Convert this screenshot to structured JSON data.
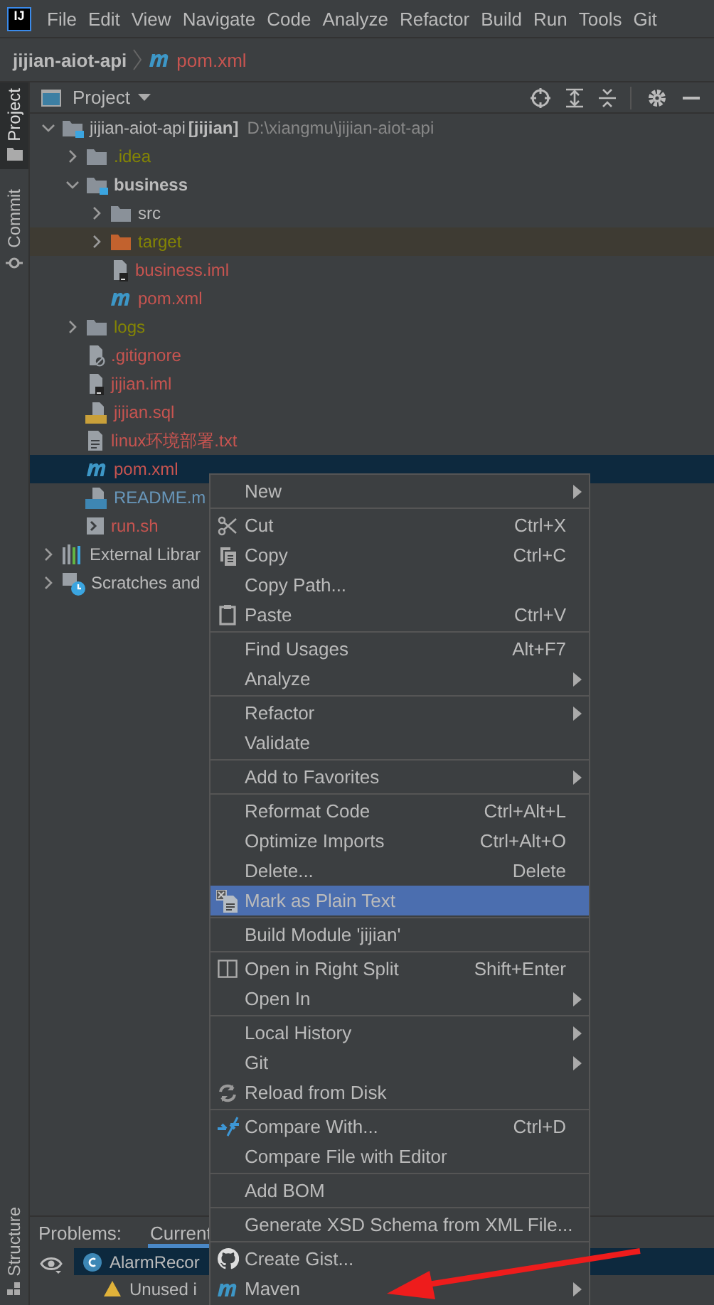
{
  "logo": "IJ",
  "menu_bar": [
    "File",
    "Edit",
    "View",
    "Navigate",
    "Code",
    "Analyze",
    "Refactor",
    "Build",
    "Run",
    "Tools",
    "Git"
  ],
  "breadcrumb": {
    "project": "jijian-aiot-api",
    "file": "pom.xml"
  },
  "left_stripe": [
    {
      "label": "Project",
      "selected": true
    },
    {
      "label": "Commit",
      "selected": false
    }
  ],
  "left_stripe_bottom": {
    "label": "Structure"
  },
  "project_panel": {
    "title": "Project",
    "tree": [
      {
        "name": "jijian-aiot-api",
        "module": "[jijian]",
        "path": "D:\\xiangmu\\jijian-aiot-api",
        "kind": "module",
        "color": "#bbbbbb",
        "expanded": true,
        "selected": false,
        "children": [
          {
            "name": ".idea",
            "kind": "folder",
            "color": "#848504",
            "expanded": false,
            "selected": false
          },
          {
            "name": "business",
            "kind": "module",
            "color": "#bbbbbb",
            "expanded": true,
            "selected": false,
            "children": [
              {
                "name": "src",
                "kind": "folder",
                "color": "#bbbbbb",
                "expanded": false,
                "selected": false
              },
              {
                "name": "target",
                "kind": "excluded",
                "color": "#848504",
                "expanded": false,
                "selected": false
              },
              {
                "name": "business.iml",
                "kind": "iml",
                "color": "#c75450",
                "selected": false
              },
              {
                "name": "pom.xml",
                "kind": "maven",
                "color": "#c75450",
                "selected": false
              }
            ]
          },
          {
            "name": "logs",
            "kind": "folder",
            "color": "#848504",
            "expanded": false,
            "selected": false
          },
          {
            "name": ".gitignore",
            "kind": "gitignore",
            "color": "#c75450",
            "selected": false
          },
          {
            "name": "jijian.iml",
            "kind": "iml",
            "color": "#c75450",
            "selected": false
          },
          {
            "name": "jijian.sql",
            "kind": "sql",
            "color": "#c75450",
            "selected": false
          },
          {
            "name": "linux环境部署.txt",
            "kind": "text",
            "color": "#c75450",
            "selected": false
          },
          {
            "name": "pom.xml",
            "kind": "maven",
            "color": "#c75450",
            "selected": true
          },
          {
            "name": "README.m",
            "kind": "markdown",
            "color": "#6897bb",
            "selected": false
          },
          {
            "name": "run.sh",
            "kind": "shell",
            "color": "#c75450",
            "selected": false
          }
        ]
      },
      {
        "name": "External Librar",
        "kind": "libraries",
        "color": "#bbbbbb",
        "expanded": false,
        "selected": false
      },
      {
        "name": "Scratches and",
        "kind": "scratches",
        "color": "#bbbbbb",
        "expanded": false,
        "selected": false
      }
    ]
  },
  "problems": {
    "label": "Problems:",
    "tabs": [
      {
        "label": "Current",
        "selected": true
      }
    ],
    "rows": [
      {
        "text": "AlarmRecor",
        "kind": "class",
        "selected": true
      },
      {
        "text": "Unused i",
        "kind": "warning",
        "selected": false
      }
    ]
  },
  "context_menu": [
    {
      "kind": "item",
      "label": "New",
      "submenu": true,
      "selected": false
    },
    {
      "kind": "separator"
    },
    {
      "kind": "scissors",
      "label": "Cut",
      "shortcut": "Ctrl+X",
      "submenu": false,
      "selected": false
    },
    {
      "kind": "copy",
      "label": "Copy",
      "shortcut": "Ctrl+C",
      "submenu": false,
      "selected": false
    },
    {
      "kind": "item",
      "label": "Copy Path...",
      "submenu": false,
      "selected": false
    },
    {
      "kind": "clipboard",
      "label": "Paste",
      "shortcut": "Ctrl+V",
      "submenu": false,
      "selected": false
    },
    {
      "kind": "separator"
    },
    {
      "kind": "item",
      "label": "Find Usages",
      "shortcut": "Alt+F7",
      "submenu": false,
      "selected": false
    },
    {
      "kind": "item",
      "label": "Analyze",
      "submenu": true,
      "selected": false
    },
    {
      "kind": "separator"
    },
    {
      "kind": "item",
      "label": "Refactor",
      "submenu": true,
      "selected": false
    },
    {
      "kind": "item",
      "label": "Validate",
      "submenu": false,
      "selected": false
    },
    {
      "kind": "separator"
    },
    {
      "kind": "item",
      "label": "Add to Favorites",
      "submenu": true,
      "selected": false
    },
    {
      "kind": "separator"
    },
    {
      "kind": "item",
      "label": "Reformat Code",
      "shortcut": "Ctrl+Alt+L",
      "submenu": false,
      "selected": false
    },
    {
      "kind": "item",
      "label": "Optimize Imports",
      "shortcut": "Ctrl+Alt+O",
      "submenu": false,
      "selected": false
    },
    {
      "kind": "item",
      "label": "Delete...",
      "shortcut": "Delete",
      "submenu": false,
      "selected": false
    },
    {
      "kind": "plaintext",
      "label": "Mark as Plain Text",
      "submenu": false,
      "selected": true
    },
    {
      "kind": "separator"
    },
    {
      "kind": "item",
      "label": "Build Module 'jijian'",
      "submenu": false,
      "selected": false
    },
    {
      "kind": "separator"
    },
    {
      "kind": "split",
      "label": "Open in Right Split",
      "shortcut": "Shift+Enter",
      "submenu": false,
      "selected": false
    },
    {
      "kind": "item",
      "label": "Open In",
      "submenu": true,
      "selected": false
    },
    {
      "kind": "separator"
    },
    {
      "kind": "item",
      "label": "Local History",
      "submenu": true,
      "selected": false
    },
    {
      "kind": "item",
      "label": "Git",
      "submenu": true,
      "selected": false
    },
    {
      "kind": "reload",
      "label": "Reload from Disk",
      "submenu": false,
      "selected": false
    },
    {
      "kind": "separator"
    },
    {
      "kind": "compare",
      "label": "Compare With...",
      "shortcut": "Ctrl+D",
      "submenu": false,
      "selected": false
    },
    {
      "kind": "item",
      "label": "Compare File with Editor",
      "submenu": false,
      "selected": false
    },
    {
      "kind": "separator"
    },
    {
      "kind": "item",
      "label": "Add BOM",
      "submenu": false,
      "selected": false
    },
    {
      "kind": "separator"
    },
    {
      "kind": "item",
      "label": "Generate XSD Schema from XML File...",
      "submenu": false,
      "selected": false
    },
    {
      "kind": "separator"
    },
    {
      "kind": "github",
      "label": "Create Gist...",
      "submenu": false,
      "selected": false
    },
    {
      "kind": "maven",
      "label": "Maven",
      "submenu": true,
      "selected": false
    }
  ]
}
